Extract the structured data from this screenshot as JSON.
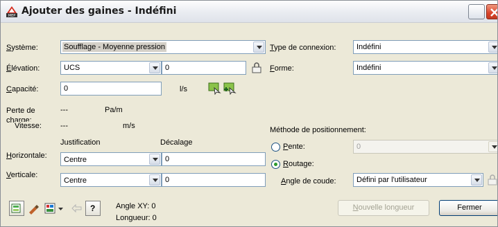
{
  "title": "Ajouter des gaines - Indéfini",
  "colors": {
    "title_text": "#1b1b1b",
    "close_button": "#d9432a",
    "radio_selected": "#2b9a2b",
    "input_border": "#7f9db9"
  },
  "systeme": {
    "label_first": "S",
    "label_rest": "ystème:",
    "value": "Soufflage - Moyenne pression"
  },
  "elevation": {
    "label_first": "É",
    "label_rest": "lévation:",
    "combo_value": "UCS",
    "input_value": "0"
  },
  "capacite": {
    "label_first": "C",
    "label_rest": "apacité:",
    "value": "0",
    "unit": "l/s"
  },
  "perte": {
    "label": "Perte de charge:",
    "value": "---",
    "unit": "Pa/m"
  },
  "vitesse": {
    "label": "Vitesse:",
    "value": "---",
    "unit": "m/s"
  },
  "offsets": {
    "justification_header": "Justification",
    "decalage_header": "Décalage"
  },
  "horizontale": {
    "label_first": "H",
    "label_rest": "orizontale:",
    "justification": "Centre",
    "decalage": "0"
  },
  "verticale": {
    "label_first": "V",
    "label_rest": "erticale:",
    "justification": "Centre",
    "decalage": "0"
  },
  "type_connexion": {
    "label_first": "T",
    "label_rest": "ype de connexion:",
    "value": "Indéfini"
  },
  "forme": {
    "label_first": "F",
    "label_rest": "orme:",
    "value": "Indéfini"
  },
  "positionnement": {
    "header": "Méthode de positionnement:",
    "pente": {
      "label_first": "P",
      "label_rest": "ente:",
      "value": "0",
      "selected": false
    },
    "routage": {
      "label_first": "R",
      "label_rest": "outage:",
      "selected": true
    },
    "angle_coude": {
      "label_first": "A",
      "label_rest": "ngle de coude:",
      "value": "Défini par l'utilisateur"
    }
  },
  "status": {
    "angle_xy": "Angle XY: 0",
    "longueur": "Longueur: 0"
  },
  "buttons": {
    "nouvelle_longueur_first": "N",
    "nouvelle_longueur_rest": "ouvelle longueur",
    "fermer": "Fermer",
    "help": "?"
  },
  "icons": [
    "app-logo-icon",
    "duct-properties-icon",
    "match-properties-icon",
    "justification-icon",
    "undo-icon",
    "help-icon",
    "lock-icon",
    "capacity-icon",
    "capacity-add-icon"
  ]
}
